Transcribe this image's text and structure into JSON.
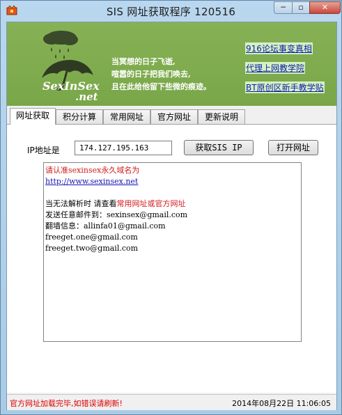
{
  "window": {
    "title": "SIS 网址获取程序 120516",
    "controls": {
      "minimize": "─",
      "maximize": "▫",
      "close": "✕"
    }
  },
  "banner": {
    "logo_text": "SexInSex",
    "logo_sub": ".net",
    "poem": [
      "当冥想的日子飞逝,",
      "喧嚣的日子把我们唤去,",
      "且在此给他留下些微的痕迹。"
    ],
    "links": [
      "916论坛事变真相",
      "代理上网教学院",
      "BT原创区新手教学贴"
    ]
  },
  "tabs": [
    "网址获取",
    "积分计算",
    "常用网址",
    "官方网址",
    "更新说明"
  ],
  "form": {
    "ip_label": "IP地址是",
    "ip_value": "174.127.195.163",
    "get_ip_button": "获取SIS IP",
    "open_button": "打开网址"
  },
  "info": {
    "line1": "请认准sexinsex永久域名为",
    "url": "http://www.sexinsex.net",
    "line3_prefix": "当无法解析时 请查看",
    "line3_red": "常用网址或官方网址",
    "email_label": "发送任意邮件到：",
    "email": "sexinsex@gmail.com",
    "wall_label": "翻墙信息：",
    "wall_email": "allinfa01@gmail.com",
    "freeget1": "freeget.one@gmail.com",
    "freeget2": "freeget.two@gmail.com"
  },
  "status": {
    "left": "官方网址加载完毕,如错误请刷新!",
    "right": "2014年08月22日 11:06:05"
  },
  "colors": {
    "banner": "#7fac4e",
    "link": "#0b1fa8",
    "error": "#d21919"
  }
}
